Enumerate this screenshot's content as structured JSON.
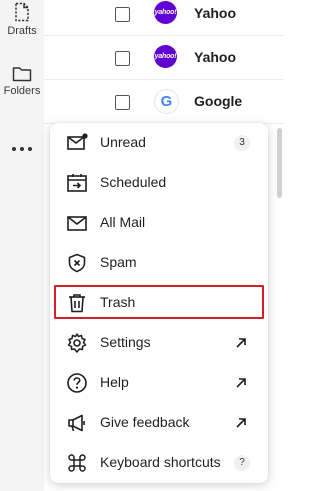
{
  "sidebar": {
    "drafts_label": "Drafts",
    "folders_label": "Folders",
    "more_icon": "more-dots-icon"
  },
  "messages": [
    {
      "sender": "Yahoo",
      "avatar": "yahoo!"
    },
    {
      "sender": "Yahoo",
      "avatar": "yahoo!"
    },
    {
      "sender": "Google",
      "avatar": "G"
    }
  ],
  "menu": {
    "items": [
      {
        "label": "Unread",
        "icon": "unread-mail-icon",
        "badge": "3"
      },
      {
        "label": "Scheduled",
        "icon": "scheduled-icon"
      },
      {
        "label": "All Mail",
        "icon": "all-mail-icon"
      },
      {
        "label": "Spam",
        "icon": "spam-shield-icon"
      },
      {
        "label": "Trash",
        "icon": "trash-icon"
      },
      {
        "label": "Settings",
        "icon": "gear-icon"
      },
      {
        "label": "Help",
        "icon": "help-icon"
      },
      {
        "label": "Give feedback",
        "icon": "megaphone-icon"
      },
      {
        "label": "Keyboard shortcuts",
        "icon": "command-key-icon",
        "badge": "?"
      }
    ]
  },
  "colors": {
    "highlight": "#d91c2a",
    "yahoo_purple": "#6001d2",
    "google_blue": "#4285f4"
  }
}
